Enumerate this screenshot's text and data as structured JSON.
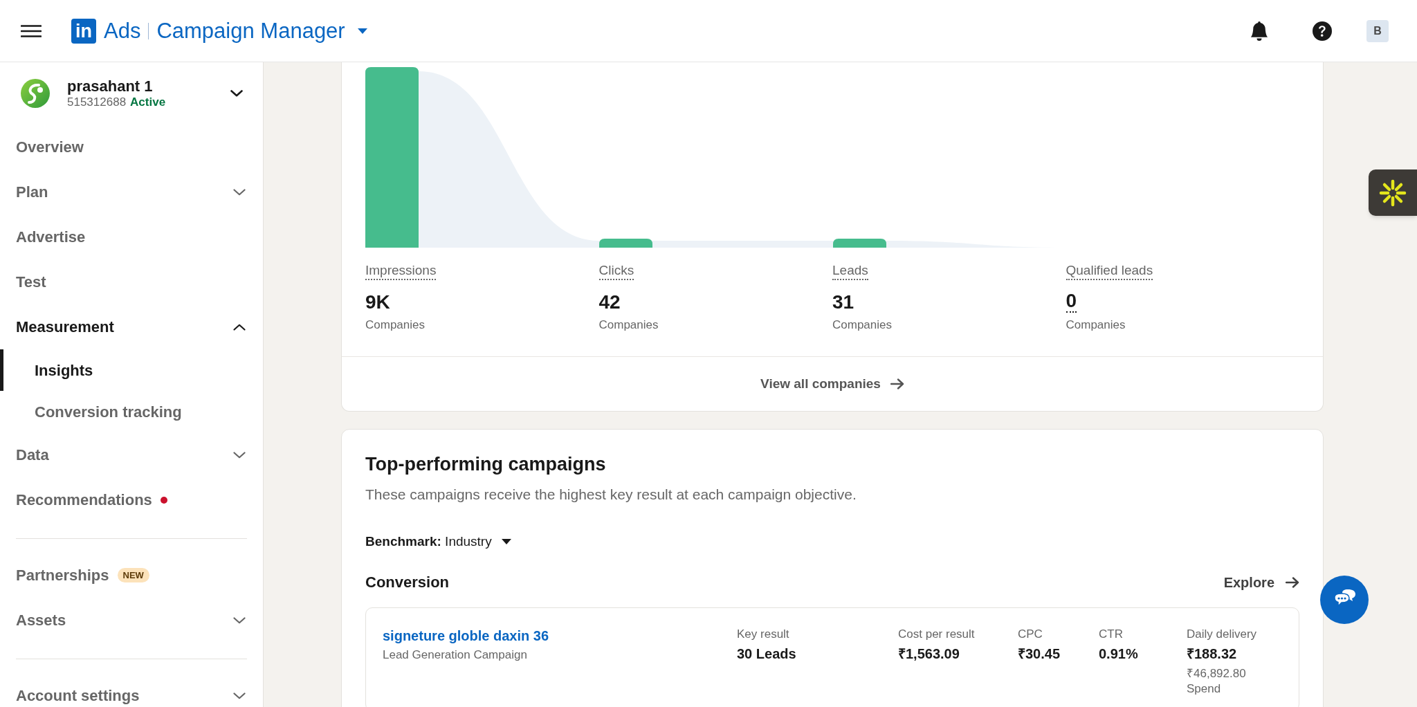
{
  "header": {
    "logo_mark": "in",
    "product": "Ads",
    "title": "Campaign Manager",
    "avatar": "B"
  },
  "account": {
    "name": "prasahant 1",
    "id": "515312688",
    "status": "Active"
  },
  "sidebar": {
    "items": [
      {
        "kind": "link",
        "label": "Overview",
        "selected": false
      },
      {
        "kind": "group",
        "label": "Plan",
        "selected": false,
        "expanded": false
      },
      {
        "kind": "link",
        "label": "Advertise",
        "selected": false
      },
      {
        "kind": "link",
        "label": "Test",
        "selected": false
      },
      {
        "kind": "group",
        "label": "Measurement",
        "selected": false,
        "expanded": true,
        "children": [
          {
            "kind": "link",
            "label": "Insights",
            "selected": true
          },
          {
            "kind": "link",
            "label": "Conversion tracking",
            "selected": false
          }
        ]
      },
      {
        "kind": "group",
        "label": "Data",
        "selected": false,
        "expanded": false
      },
      {
        "kind": "link",
        "label": "Recommendations",
        "selected": false,
        "dot": true
      },
      {
        "kind": "divider"
      },
      {
        "kind": "link",
        "label": "Partnerships",
        "selected": false,
        "badge": "NEW"
      },
      {
        "kind": "group",
        "label": "Assets",
        "selected": false,
        "expanded": false
      },
      {
        "kind": "divider"
      },
      {
        "kind": "group",
        "label": "Account settings",
        "selected": false,
        "expanded": false
      }
    ]
  },
  "funnel": {
    "stages": [
      {
        "label": "Impressions",
        "value": "9K",
        "unit": "Companies",
        "has_tooltip": false
      },
      {
        "label": "Clicks",
        "value": "42",
        "unit": "Companies",
        "has_tooltip": false
      },
      {
        "label": "Leads",
        "value": "31",
        "unit": "Companies",
        "has_tooltip": false
      },
      {
        "label": "Qualified leads",
        "value": "0",
        "unit": "Companies",
        "has_tooltip": true
      }
    ],
    "link": "View all companies"
  },
  "top_campaigns": {
    "title": "Top-performing campaigns",
    "subtitle": "These campaigns receive the highest key result at each campaign objective.",
    "benchmark": "**Benchmark:** Industry",
    "sections": [
      {
        "objective": "Conversion",
        "link": "Explore",
        "campaigns": [
          {
            "name": "signeture globle daxin 36",
            "type": "Lead Generation Campaign",
            "metrics": [
              {
                "label": "Key result",
                "value": "30 Leads"
              },
              {
                "label": "Cost per result",
                "value": "₹1,563.09"
              },
              {
                "label": "CPC",
                "value": "₹30.45"
              },
              {
                "label": "CTR",
                "value": "0.91%"
              },
              {
                "label": "Daily delivery",
                "value": "₹188.32",
                "note": "₹46,892.80",
                "note_label": "Spend"
              }
            ]
          }
        ]
      }
    ]
  }
}
